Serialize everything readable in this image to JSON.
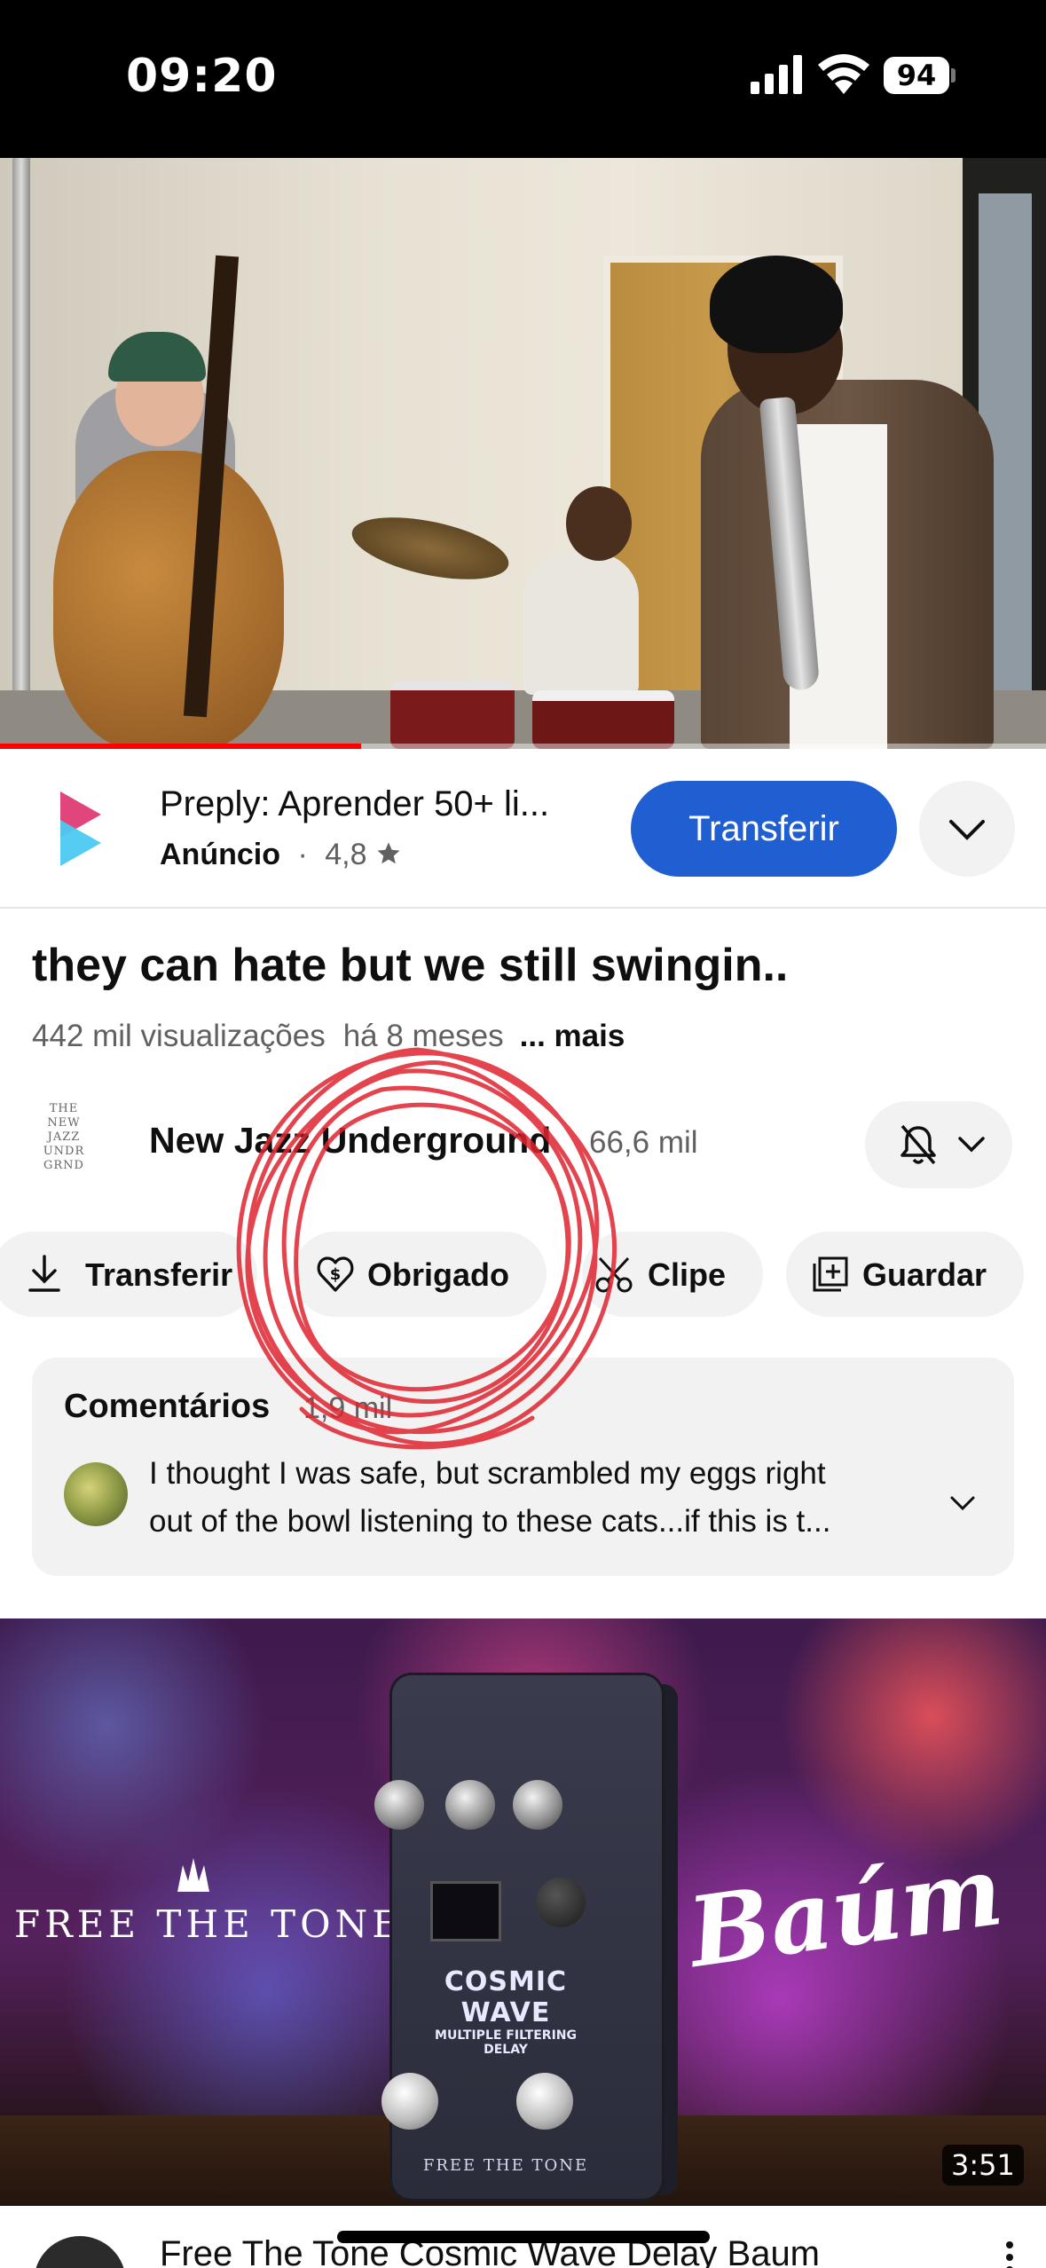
{
  "status_bar": {
    "time": "09:20",
    "battery": "94",
    "icons": [
      "signal-icon",
      "wifi-icon",
      "battery-icon"
    ]
  },
  "player": {
    "progress_fraction": 0.345,
    "progress_color": "#ff0000"
  },
  "ad": {
    "title": "Preply: Aprender 50+ li...",
    "sponsor_label": "Anúncio",
    "separator": "·",
    "rating": "4,8",
    "rating_icon": "star-icon",
    "install_label": "Transferir",
    "expand_icon": "chevron-down-icon",
    "accent_color": "#1f5fd1"
  },
  "video": {
    "title": "they can hate but we still swingin..",
    "views": "442 mil visualizações",
    "age": "há 8 meses",
    "more_label": "... mais"
  },
  "channel": {
    "avatar_text": [
      "THE",
      "NEW",
      "JAZZ",
      "UNDR",
      "GRND"
    ],
    "name": "New Jazz Underground",
    "subscribers": "66,6 mil",
    "notification_icon": "bell-off-icon"
  },
  "actions": [
    {
      "label": "Transferir",
      "icon": "download-icon"
    },
    {
      "label": "Obrigado",
      "icon": "heart-dollar-icon"
    },
    {
      "label": "Clipe",
      "icon": "scissors-icon"
    },
    {
      "label": "Guardar",
      "icon": "add-to-playlist-icon"
    }
  ],
  "comments": {
    "title": "Comentários",
    "count": "1,9 mil",
    "top_comment_line1": "I thought I was safe, but scrambled my eggs right",
    "top_comment_line2": "out of the bowl listening to these cats...if this is t..."
  },
  "next_video": {
    "thumbnail": {
      "brand_left": "FREE THE TONE.",
      "brand_right": "Baúm",
      "pedal_name": "COSMIC WAVE",
      "pedal_subtitle": "MULTIPLE FILTERING DELAY",
      "pedal_maker": "FREE THE TONE"
    },
    "duration": "3:51",
    "title": "Free The Tone Cosmic Wave Delay Baum",
    "menu_icon": "more-vertical-icon"
  }
}
